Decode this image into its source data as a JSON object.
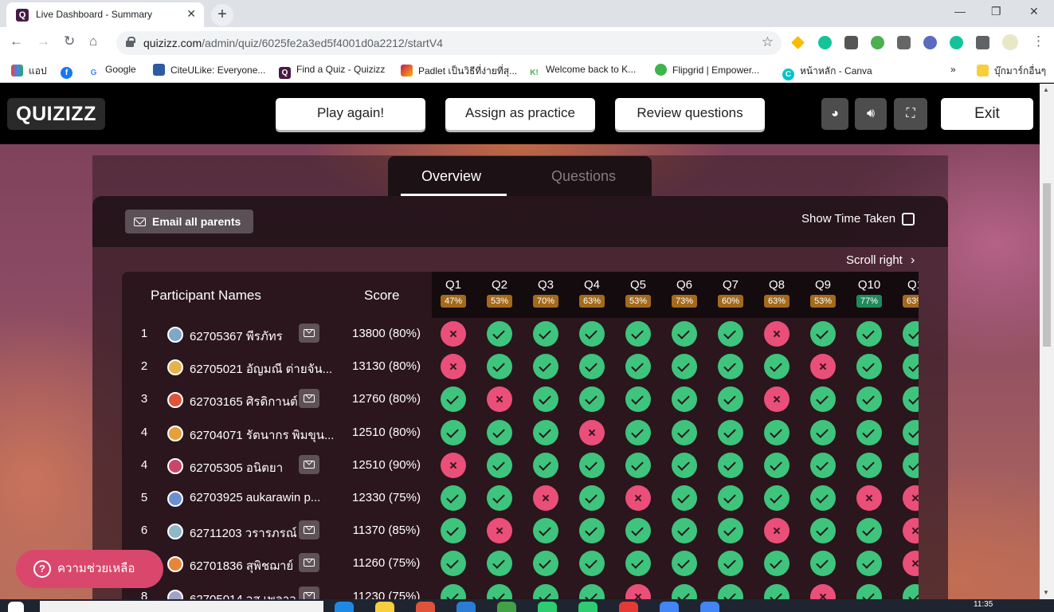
{
  "browser": {
    "tab_title": "Live Dashboard - Summary",
    "tab_close": "✕",
    "new_tab": "+",
    "url_domain": "quizizz.com",
    "url_path": "/admin/quiz/6025fe2a3ed5f4001d0a2212/startV4",
    "window_controls": [
      "—",
      "❐",
      "✕"
    ],
    "bookmarks": [
      {
        "label": "แอป",
        "icon": "apps-grid-icon",
        "color": "#ea4335"
      },
      {
        "label": "",
        "icon": "facebook-icon",
        "color": "#1877f2"
      },
      {
        "label": "Google",
        "icon": "google-icon",
        "color": "#4285f4"
      },
      {
        "label": "CiteULike: Everyone...",
        "icon": "citeulike-icon",
        "color": "#2d5aa0"
      },
      {
        "label": "Find a Quiz - Quizizz",
        "icon": "quizizz-icon",
        "color": "#461a42"
      },
      {
        "label": "Padlet เป็นวิธีที่ง่ายที่สุ...",
        "icon": "padlet-icon",
        "color": "#c2185b"
      },
      {
        "label": "Welcome back to K...",
        "icon": "kahoot-icon",
        "color": "#4caf50"
      },
      {
        "label": "Flipgrid | Empower...",
        "icon": "flipgrid-icon",
        "color": "#3bb54a"
      },
      {
        "label": "หน้าหลัก - Canva",
        "icon": "canva-icon",
        "color": "#00c4cc"
      },
      {
        "label": "»",
        "icon": "",
        "color": ""
      },
      {
        "label": "บุ๊กมาร์กอื่นๆ",
        "icon": "folder-icon",
        "color": "#f9ce3c"
      }
    ]
  },
  "quizizz": {
    "logo": "QUIZIZZ",
    "buttons": {
      "play_again": "Play again!",
      "assign": "Assign as practice",
      "review": "Review questions",
      "exit": "Exit"
    },
    "icon_buttons": [
      "palette-icon",
      "sound-icon",
      "fullscreen-icon"
    ],
    "tabs": {
      "overview": "Overview",
      "questions": "Questions"
    },
    "email_all_parents": "Email all parents",
    "show_time_taken": "Show Time Taken",
    "scroll_right": "Scroll right",
    "col_participant": "Participant Names",
    "col_score": "Score",
    "questions": [
      {
        "label": "Q1",
        "pct": "47%",
        "color": "#a46a1c"
      },
      {
        "label": "Q2",
        "pct": "53%",
        "color": "#a46a1c"
      },
      {
        "label": "Q3",
        "pct": "70%",
        "color": "#a46a1c"
      },
      {
        "label": "Q4",
        "pct": "63%",
        "color": "#a46a1c"
      },
      {
        "label": "Q5",
        "pct": "53%",
        "color": "#a46a1c"
      },
      {
        "label": "Q6",
        "pct": "73%",
        "color": "#a46a1c"
      },
      {
        "label": "Q7",
        "pct": "60%",
        "color": "#a46a1c"
      },
      {
        "label": "Q8",
        "pct": "63%",
        "color": "#a46a1c"
      },
      {
        "label": "Q9",
        "pct": "53%",
        "color": "#a46a1c"
      },
      {
        "label": "Q10",
        "pct": "77%",
        "color": "#1f8a5c"
      },
      {
        "label": "Q1",
        "pct": "63%",
        "color": "#a46a1c"
      }
    ],
    "participants": [
      {
        "rank": "1",
        "name": "62705367 พีรภัทร",
        "score": "13800 (80%)",
        "mail": true,
        "avatar": "#7fa7c9",
        "answers": [
          0,
          1,
          1,
          1,
          1,
          1,
          1,
          0,
          1,
          1,
          1
        ]
      },
      {
        "rank": "2",
        "name": "62705021 อัญมณี ต่ายจัน...",
        "score": "13130 (80%)",
        "mail": false,
        "avatar": "#e6b34a",
        "answers": [
          0,
          1,
          1,
          1,
          1,
          1,
          1,
          1,
          0,
          1,
          1
        ]
      },
      {
        "rank": "3",
        "name": "62703165 ศิรดิกานต์",
        "score": "12760 (80%)",
        "mail": true,
        "avatar": "#e0533b",
        "answers": [
          1,
          0,
          1,
          1,
          1,
          1,
          1,
          0,
          1,
          1,
          1
        ]
      },
      {
        "rank": "4",
        "name": "62704071 รัตนากร พิมขุน...",
        "score": "12510 (80%)",
        "mail": false,
        "avatar": "#e6a03a",
        "answers": [
          1,
          1,
          1,
          0,
          1,
          1,
          1,
          1,
          1,
          1,
          1
        ]
      },
      {
        "rank": "4",
        "name": "62705305 อนิตยา",
        "score": "12510 (90%)",
        "mail": true,
        "avatar": "#c9466a",
        "answers": [
          0,
          1,
          1,
          1,
          1,
          1,
          1,
          1,
          1,
          1,
          1
        ]
      },
      {
        "rank": "5",
        "name": "62703925 aukarawin p...",
        "score": "12330 (75%)",
        "mail": false,
        "avatar": "#6b8fd1",
        "answers": [
          1,
          1,
          0,
          1,
          0,
          1,
          1,
          1,
          1,
          0,
          0
        ]
      },
      {
        "rank": "6",
        "name": "62711203 วรารภรณ์",
        "score": "11370 (85%)",
        "mail": true,
        "avatar": "#8fb7c7",
        "answers": [
          1,
          0,
          1,
          1,
          1,
          1,
          1,
          0,
          1,
          1,
          0
        ]
      },
      {
        "rank": "7",
        "name": "62701836 สุพิชฌาย์",
        "score": "11260 (75%)",
        "mail": true,
        "avatar": "#e6863a",
        "answers": [
          1,
          1,
          1,
          1,
          1,
          1,
          1,
          1,
          1,
          1,
          0
        ]
      },
      {
        "rank": "8",
        "name": "62705014 วส เพลาว",
        "score": "11230 (75%)",
        "mail": true,
        "avatar": "#a3a3c9",
        "answers": [
          1,
          1,
          1,
          1,
          0,
          1,
          1,
          1,
          0,
          1,
          1
        ]
      }
    ],
    "help_label": "ความช่วยเหลือ"
  },
  "taskbar": {
    "clock": "11:35"
  }
}
